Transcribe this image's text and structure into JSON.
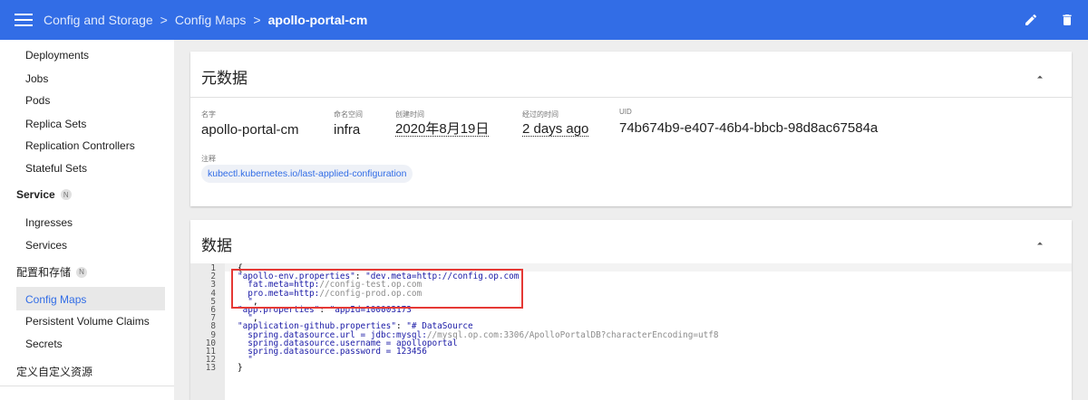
{
  "breadcrumb": {
    "items": [
      "Config and Storage",
      "Config Maps"
    ],
    "separator": ">",
    "current": "apollo-portal-cm"
  },
  "top_actions": {
    "edit_icon": "pencil-icon",
    "delete_icon": "trash-icon"
  },
  "sidebar": {
    "items_top": [
      "Deployments",
      "Jobs",
      "Pods",
      "Replica Sets",
      "Replication Controllers",
      "Stateful Sets"
    ],
    "service_section": {
      "label": "Service",
      "badge": "N"
    },
    "service_items": [
      "Ingresses",
      "Services"
    ],
    "config_section": {
      "label": "配置和存储",
      "badge": "N"
    },
    "config_items": [
      "Config Maps",
      "Persistent Volume Claims",
      "Secrets"
    ],
    "custom_resources": "定义自定义资源"
  },
  "metadata": {
    "title": "元数据",
    "name_label": "名字",
    "name_value": "apollo-portal-cm",
    "namespace_label": "命名空间",
    "namespace_value": "infra",
    "created_label": "创建时间",
    "created_value": "2020年8月19日",
    "age_label": "经过的时间",
    "age_value": "2 days ago",
    "uid_label": "UID",
    "uid_value": "74b674b9-e407-46b4-bbcb-98d8ac67584a",
    "annotations_label": "注释",
    "annotation_chip": "kubectl.kubernetes.io/last-applied-configuration"
  },
  "data_section": {
    "title": "数据",
    "line_numbers": [
      "1",
      "2",
      "3",
      "4",
      "5",
      "6",
      "7",
      "8",
      "9",
      "10",
      "11",
      "12",
      "13"
    ],
    "lines": [
      {
        "parts": [
          [
            "p",
            "{"
          ]
        ]
      },
      {
        "parts": [
          [
            "k",
            "\"apollo-env.properties\""
          ],
          [
            "p",
            ": "
          ],
          [
            "s",
            "\"dev.meta=http://config.op.com"
          ]
        ]
      },
      {
        "parts": [
          [
            "s",
            "  fat.meta=http:"
          ],
          [
            "q",
            "//config-test.op.com"
          ]
        ]
      },
      {
        "parts": [
          [
            "s",
            "  pro.meta=http:"
          ],
          [
            "q",
            "//config-prod.op.com"
          ]
        ]
      },
      {
        "parts": [
          [
            "s",
            "  \""
          ],
          [
            "p",
            ","
          ]
        ]
      },
      {
        "parts": [
          [
            "k",
            "\"app.properties\""
          ],
          [
            "p",
            ": "
          ],
          [
            "s",
            "\"appId=100003173"
          ]
        ]
      },
      {
        "parts": [
          [
            "s",
            "  \""
          ],
          [
            "p",
            ","
          ]
        ]
      },
      {
        "parts": [
          [
            "k",
            "\"application-github.properties\""
          ],
          [
            "p",
            ": "
          ],
          [
            "s",
            "\"# DataSource"
          ]
        ]
      },
      {
        "parts": [
          [
            "s",
            "  spring.datasource.url = jdbc:mysql:"
          ],
          [
            "q",
            "//mysql.op.com:3306/ApolloPortalDB?characterEncoding=utf8"
          ]
        ]
      },
      {
        "parts": [
          [
            "s",
            "  spring.datasource.username = apolloportal"
          ]
        ]
      },
      {
        "parts": [
          [
            "s",
            "  spring.datasource.password = 123456"
          ]
        ]
      },
      {
        "parts": [
          [
            "s",
            "  \""
          ]
        ]
      },
      {
        "parts": [
          [
            "p",
            "}"
          ]
        ]
      }
    ]
  },
  "colors": {
    "topbar": "#326de6",
    "accent": "#326de6",
    "highlight_box": "#e53935"
  }
}
